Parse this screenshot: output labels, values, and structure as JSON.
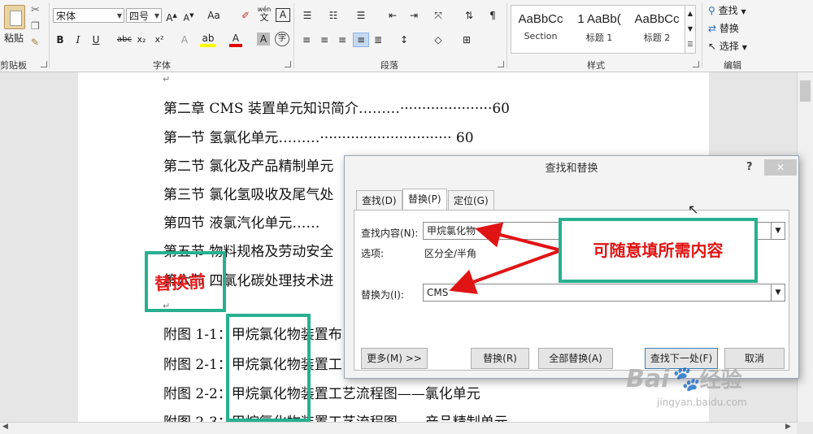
{
  "ribbon": {
    "clipboard": {
      "paste_label": "粘贴",
      "group_label": "剪贴板"
    },
    "font": {
      "font_name": "宋体",
      "font_size": "四号",
      "change_case": "Aa",
      "phonetic_top": "wén",
      "phonetic_bottom": "文",
      "bold": "B",
      "italic": "I",
      "underline": "U",
      "strike": "abc",
      "subscript": "x₂",
      "superscript": "x²",
      "group_label": "字体"
    },
    "paragraph": {
      "group_label": "段落"
    },
    "styles": {
      "items": [
        {
          "sample": "AaBbCc",
          "name": "Section"
        },
        {
          "sample": "1 AaBb(",
          "name": "标题 1"
        },
        {
          "sample": "AaBbCc",
          "name": "标题 2"
        }
      ],
      "group_label": "样式"
    },
    "editing": {
      "find": "查找",
      "replace": "替换",
      "select": "选择",
      "group_label": "编辑"
    }
  },
  "document": {
    "lines": [
      "第二章 CMS 装置单元知识简介………·····················60",
      "第一节  氢氯化单元………······························ 60",
      "第二节  氯化及产品精制单元",
      "第三节  氯化氢吸收及尾气处",
      "第四节  液氯汽化单元……",
      "第五节  物料规格及劳动安全",
      "第六节  四氯化碳处理技术进",
      "附图 1-1：甲烷氯化物装置布",
      "附图 2-1：甲烷氯化物装置工",
      "附图 2-2：甲烷氯化物装置工艺流程图——氯化单元",
      "附图 2-3：甲烷氯化物装置工艺流程图——产品精制单元"
    ],
    "annotation_before": "替换前"
  },
  "dialog": {
    "title": "查找和替换",
    "help": "?",
    "close": "✕",
    "tabs": [
      "查找(D)",
      "替换(P)",
      "定位(G)"
    ],
    "find_label": "查找内容(N):",
    "find_value": "甲烷氯化物",
    "options_label": "选项:",
    "options_value": "区分全/半角",
    "replace_label": "替换为(I):",
    "replace_value": "CMS",
    "buttons": {
      "more": "更多(M) >>",
      "replace": "替换(R)",
      "replace_all": "全部替换(A)",
      "find_next": "查找下一处(F)",
      "cancel": "取消"
    }
  },
  "callout": "可随意填所需内容",
  "watermark": {
    "brand": "Bai",
    "brand2": "经验",
    "url": "jingyan.baidu.com"
  },
  "colors": {
    "annotation_green": "#27b090",
    "annotation_red": "#e61e1e"
  }
}
